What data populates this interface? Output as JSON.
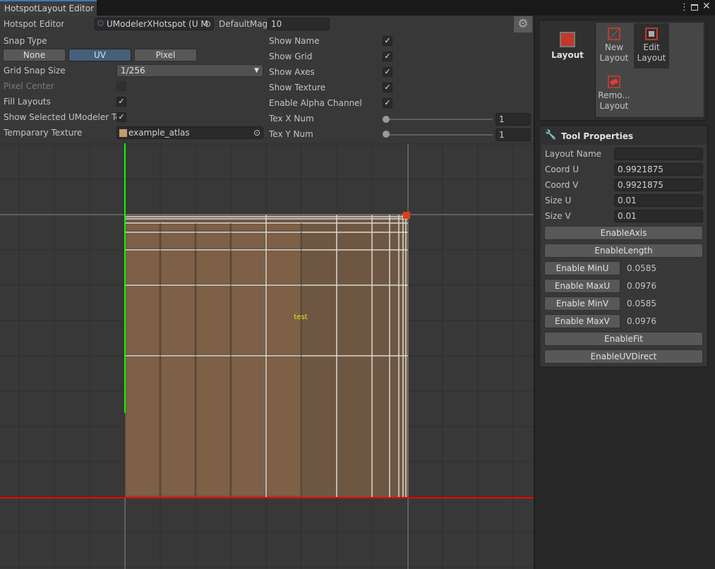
{
  "window": {
    "tab_title": "HotspotLayout Editor"
  },
  "left": {
    "hotspot_editor_label": "Hotspot Editor",
    "hotspot_editor_value": "UModelerXHotspot (U M",
    "default_mag_label": "DefaultMag",
    "default_mag_value": "10",
    "snap_type_label": "Snap Type",
    "snap_options": [
      "None",
      "UV",
      "Pixel"
    ],
    "snap_selected": "UV",
    "grid_snap_label": "Grid Snap Size",
    "grid_snap_value": "1/256",
    "pixel_center_label": "Pixel Center",
    "pixel_center_checked": false,
    "fill_layouts_label": "Fill Layouts",
    "fill_layouts_checked": true,
    "show_selected_label": "Show Selected UModeler Te",
    "show_selected_checked": true,
    "temp_texture_label": "Temparary Texture",
    "temp_texture_value": "example_atlas"
  },
  "middle": {
    "show_name": "Show Name",
    "show_grid": "Show Grid",
    "show_axes": "Show Axes",
    "show_texture": "Show Texture",
    "enable_alpha": "Enable Alpha Channel",
    "tex_x_label": "Tex X Num",
    "tex_x_value": "1",
    "tex_y_label": "Tex Y Num",
    "tex_y_value": "1"
  },
  "canvas": {
    "layout_name": "test",
    "colors": {
      "u_axis": "#00ff00",
      "v_axis": "#ff0000",
      "handle": "#e03c1c"
    }
  },
  "tools": {
    "main_label": "Layout",
    "new_layout": [
      "New",
      "Layout"
    ],
    "edit_layout": [
      "Edit",
      "Layout"
    ],
    "remove_layout": [
      "Remo...",
      "Layout"
    ],
    "selected": "Edit Layout"
  },
  "props": {
    "title": "Tool Properties",
    "layout_name_label": "Layout Name",
    "layout_name_value": "",
    "coord_u_label": "Coord U",
    "coord_u_value": "0.9921875",
    "coord_v_label": "Coord V",
    "coord_v_value": "0.9921875",
    "size_u_label": "Size U",
    "size_u_value": "0.01",
    "size_v_label": "Size V",
    "size_v_value": "0.01",
    "enable_axis": "EnableAxis",
    "enable_length": "EnableLength",
    "enable_minu": "Enable MinU",
    "minu_value": "0.05859",
    "enable_maxu": "Enable MaxU",
    "maxu_value": "0.09765",
    "enable_minv": "Enable MinV",
    "minv_value": "0.05859",
    "enable_maxv": "Enable MaxV",
    "maxv_value": "0.09765",
    "enable_fit": "EnableFit",
    "enable_uvdirect": "EnableUVDirect"
  }
}
